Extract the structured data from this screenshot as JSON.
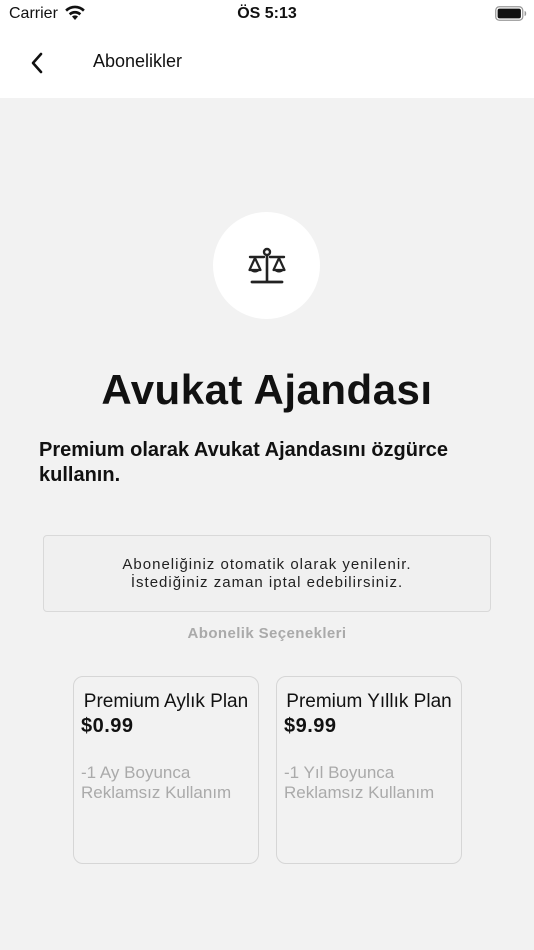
{
  "status_bar": {
    "carrier": "Carrier",
    "time": "ÖS 5:13",
    "wifi_icon": "wifi-icon",
    "battery_icon": "battery-icon"
  },
  "nav": {
    "title": "Abonelikler",
    "back_icon": "chevron-left-icon"
  },
  "hero": {
    "logo_icon": "scales-of-justice-icon",
    "app_title": "Avukat Ajandası",
    "subtitle": "Premium olarak Avukat Ajandasını özgürce kullanın."
  },
  "info": {
    "line1": "Aboneliğiniz otomatik olarak yenilenir.",
    "line2": "İstediğiniz zaman iptal edebilirsiniz."
  },
  "plans_section": {
    "label": "Abonelik Seçenekleri",
    "plans": [
      {
        "name": "Premium Aylık Plan",
        "price": "$0.99",
        "desc_line1": "-1 Ay Boyunca",
        "desc_line2": "Reklamsız Kullanım"
      },
      {
        "name": "Premium Yıllık Plan",
        "price": "$9.99",
        "desc_line1": "-1 Yıl Boyunca",
        "desc_line2": "Reklamsız Kullanım"
      }
    ]
  }
}
